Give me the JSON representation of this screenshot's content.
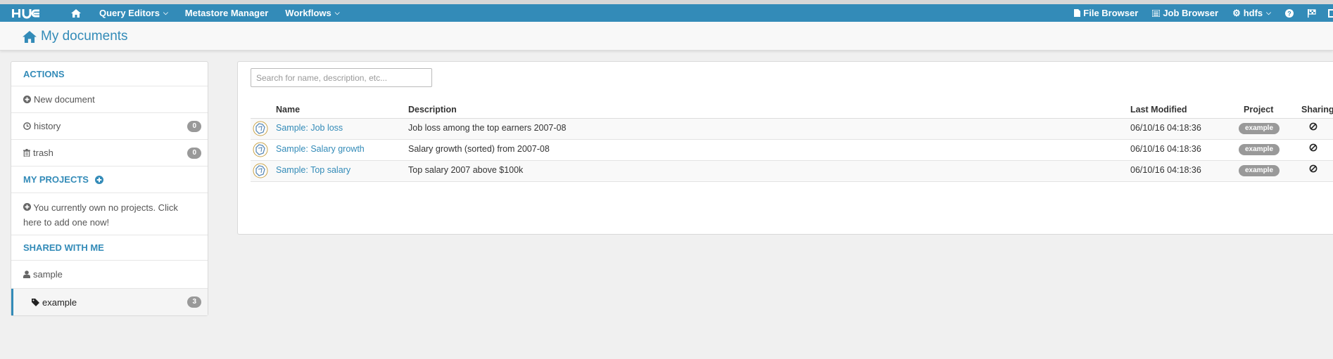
{
  "nav": {
    "logo": "HUE",
    "left": [
      {
        "label": "Query Editors",
        "dropdown": true
      },
      {
        "label": "Metastore Manager",
        "dropdown": false
      },
      {
        "label": "Workflows",
        "dropdown": true
      }
    ],
    "right": {
      "file_browser": "File Browser",
      "job_browser": "Job Browser",
      "user": "hdfs"
    }
  },
  "page": {
    "title": "My documents"
  },
  "sidebar": {
    "actions_title": "ACTIONS",
    "new_document": "New document",
    "history": {
      "label": "history",
      "count": "0"
    },
    "trash": {
      "label": "trash",
      "count": "0"
    },
    "my_projects_title": "MY PROJECTS",
    "no_projects_line1": "You currently own no projects. Click",
    "no_projects_line2": "here to add one now!",
    "shared_title": "SHARED WITH ME",
    "shared_user": "sample",
    "shared_tag": {
      "label": "example",
      "count": "3"
    }
  },
  "search": {
    "placeholder": "Search for name, description, etc..."
  },
  "table": {
    "headers": {
      "name": "Name",
      "description": "Description",
      "last_modified": "Last Modified",
      "project": "Project",
      "sharing": "Sharing"
    },
    "rows": [
      {
        "name": "Sample: Job loss",
        "description": "Job loss among the top earners 2007-08",
        "last_modified": "06/10/16 04:18:36",
        "project": "example"
      },
      {
        "name": "Sample: Salary growth",
        "description": "Salary growth (sorted) from 2007-08",
        "last_modified": "06/10/16 04:18:36",
        "project": "example"
      },
      {
        "name": "Sample: Top salary",
        "description": "Top salary 2007 above $100k",
        "last_modified": "06/10/16 04:18:36",
        "project": "example"
      }
    ]
  },
  "colors": {
    "brand": "#338bb8",
    "badge": "#999999"
  }
}
